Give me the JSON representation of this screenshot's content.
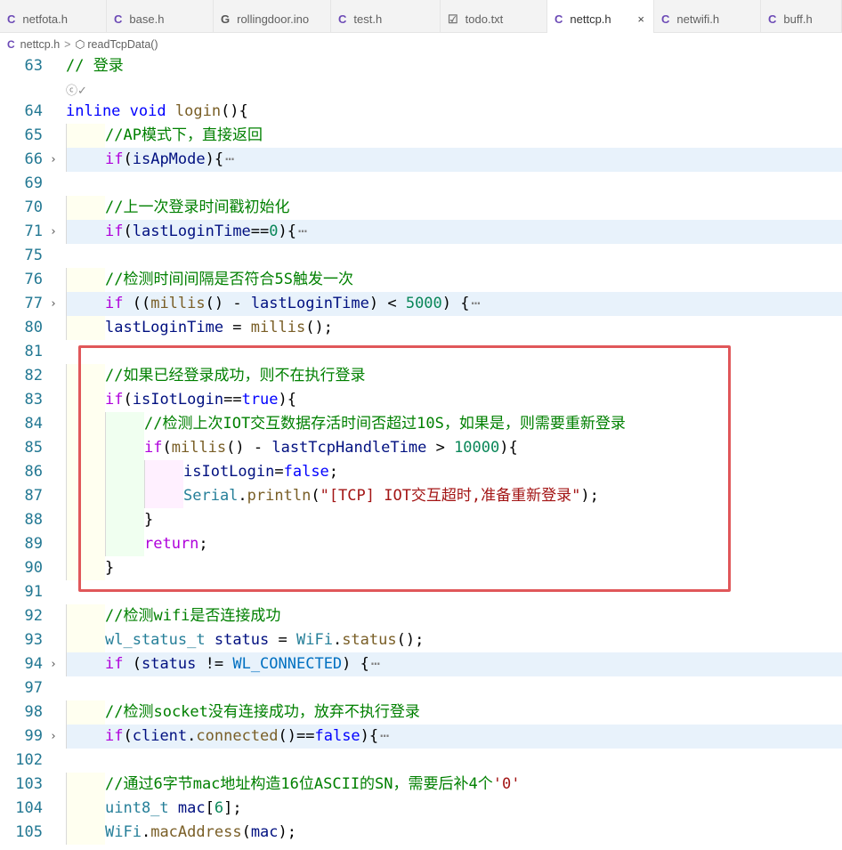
{
  "tabs": [
    {
      "icon": "C",
      "label": "netfota.h",
      "active": false
    },
    {
      "icon": "C",
      "label": "base.h",
      "active": false
    },
    {
      "icon": "G",
      "label": "rollingdoor.ino",
      "active": false
    },
    {
      "icon": "C",
      "label": "test.h",
      "active": false
    },
    {
      "icon": "☑",
      "label": "todo.txt",
      "active": false
    },
    {
      "icon": "C",
      "label": "nettcp.h",
      "active": true,
      "close": "×"
    },
    {
      "icon": "C",
      "label": "netwifi.h",
      "active": false
    },
    {
      "icon": "C",
      "label": "buff.h",
      "active": false
    }
  ],
  "breadcrumb": {
    "file": "nettcp.h",
    "separator": ">",
    "symbol": "readTcpData()"
  },
  "editor": {
    "codelens_hint": "ⓒ✓",
    "lines": [
      {
        "num": "63",
        "indent": 0,
        "tokens": [
          [
            "c",
            "// 登录"
          ]
        ]
      },
      {
        "num": "64",
        "indent": 0,
        "tokens": [
          [
            "k",
            "inline"
          ],
          [
            "p",
            " "
          ],
          [
            "k",
            "void"
          ],
          [
            "p",
            " "
          ],
          [
            "f",
            "login"
          ],
          [
            "p",
            "(){"
          ]
        ]
      },
      {
        "num": "65",
        "indent": 1,
        "tokens": [
          [
            "c",
            "//AP模式下，直接返回"
          ]
        ]
      },
      {
        "num": "66",
        "indent": 1,
        "folded": true,
        "tokens": [
          [
            "kc",
            "if"
          ],
          [
            "p",
            "("
          ],
          [
            "v",
            "isApMode"
          ],
          [
            "p",
            "){"
          ],
          [
            "e",
            "⋯"
          ]
        ]
      },
      {
        "num": "69",
        "indent": 0,
        "tokens": []
      },
      {
        "num": "70",
        "indent": 1,
        "tokens": [
          [
            "c",
            "//上一次登录时间戳初始化"
          ]
        ]
      },
      {
        "num": "71",
        "indent": 1,
        "folded": true,
        "tokens": [
          [
            "kc",
            "if"
          ],
          [
            "p",
            "("
          ],
          [
            "v",
            "lastLoginTime"
          ],
          [
            "p",
            "=="
          ],
          [
            "n",
            "0"
          ],
          [
            "p",
            "){"
          ],
          [
            "e",
            "⋯"
          ]
        ]
      },
      {
        "num": "75",
        "indent": 0,
        "tokens": []
      },
      {
        "num": "76",
        "indent": 1,
        "tokens": [
          [
            "c",
            "//检测时间间隔是否符合5S触发一次"
          ]
        ]
      },
      {
        "num": "77",
        "indent": 1,
        "folded": true,
        "tokens": [
          [
            "kc",
            "if"
          ],
          [
            "p",
            " (("
          ],
          [
            "f",
            "millis"
          ],
          [
            "p",
            "() - "
          ],
          [
            "v",
            "lastLoginTime"
          ],
          [
            "p",
            ") < "
          ],
          [
            "n",
            "5000"
          ],
          [
            "p",
            ") {"
          ],
          [
            "e",
            "⋯"
          ]
        ]
      },
      {
        "num": "80",
        "indent": 1,
        "tokens": [
          [
            "v",
            "lastLoginTime"
          ],
          [
            "p",
            " = "
          ],
          [
            "f",
            "millis"
          ],
          [
            "p",
            "();"
          ]
        ]
      },
      {
        "num": "81",
        "indent": 0,
        "tokens": []
      },
      {
        "num": "82",
        "indent": 1,
        "tokens": [
          [
            "c",
            "//如果已经登录成功，则不在执行登录"
          ]
        ]
      },
      {
        "num": "83",
        "indent": 1,
        "tokens": [
          [
            "kc",
            "if"
          ],
          [
            "p",
            "("
          ],
          [
            "v",
            "isIotLogin"
          ],
          [
            "p",
            "=="
          ],
          [
            "k",
            "true"
          ],
          [
            "p",
            "){"
          ]
        ]
      },
      {
        "num": "84",
        "indent": 2,
        "tokens": [
          [
            "c",
            "//检测上次IOT交互数据存活时间否超过10S，如果是，则需要重新登录"
          ]
        ]
      },
      {
        "num": "85",
        "indent": 2,
        "tokens": [
          [
            "kc",
            "if"
          ],
          [
            "p",
            "("
          ],
          [
            "f",
            "millis"
          ],
          [
            "p",
            "() - "
          ],
          [
            "v",
            "lastTcpHandleTime"
          ],
          [
            "p",
            " > "
          ],
          [
            "n",
            "10000"
          ],
          [
            "p",
            "){"
          ]
        ]
      },
      {
        "num": "86",
        "indent": 3,
        "tokens": [
          [
            "v",
            "isIotLogin"
          ],
          [
            "p",
            "="
          ],
          [
            "k",
            "false"
          ],
          [
            "p",
            ";"
          ]
        ]
      },
      {
        "num": "87",
        "indent": 3,
        "tokens": [
          [
            "t",
            "Serial"
          ],
          [
            "p",
            "."
          ],
          [
            "f",
            "println"
          ],
          [
            "p",
            "("
          ],
          [
            "s",
            "\"[TCP] IOT交互超时,准备重新登录\""
          ],
          [
            "p",
            ");"
          ]
        ]
      },
      {
        "num": "88",
        "indent": 2,
        "tokens": [
          [
            "p",
            "}"
          ]
        ]
      },
      {
        "num": "89",
        "indent": 2,
        "tokens": [
          [
            "kc",
            "return"
          ],
          [
            "p",
            ";"
          ]
        ]
      },
      {
        "num": "90",
        "indent": 1,
        "tokens": [
          [
            "p",
            "}"
          ]
        ]
      },
      {
        "num": "91",
        "indent": 0,
        "tokens": []
      },
      {
        "num": "92",
        "indent": 1,
        "tokens": [
          [
            "c",
            "//检测wifi是否连接成功"
          ]
        ]
      },
      {
        "num": "93",
        "indent": 1,
        "tokens": [
          [
            "t",
            "wl_status_t"
          ],
          [
            "p",
            " "
          ],
          [
            "v",
            "status"
          ],
          [
            "p",
            " = "
          ],
          [
            "t",
            "WiFi"
          ],
          [
            "p",
            "."
          ],
          [
            "f",
            "status"
          ],
          [
            "p",
            "();"
          ]
        ]
      },
      {
        "num": "94",
        "indent": 1,
        "folded": true,
        "tokens": [
          [
            "kc",
            "if"
          ],
          [
            "p",
            " ("
          ],
          [
            "v",
            "status"
          ],
          [
            "p",
            " != "
          ],
          [
            "m",
            "WL_CONNECTED"
          ],
          [
            "p",
            ") {"
          ],
          [
            "e",
            "⋯"
          ]
        ]
      },
      {
        "num": "97",
        "indent": 0,
        "tokens": []
      },
      {
        "num": "98",
        "indent": 1,
        "tokens": [
          [
            "c",
            "//检测socket没有连接成功，放弃不执行登录"
          ]
        ]
      },
      {
        "num": "99",
        "indent": 1,
        "folded": true,
        "tokens": [
          [
            "kc",
            "if"
          ],
          [
            "p",
            "("
          ],
          [
            "v",
            "client"
          ],
          [
            "p",
            "."
          ],
          [
            "f",
            "connected"
          ],
          [
            "p",
            "()=="
          ],
          [
            "k",
            "false"
          ],
          [
            "p",
            "){"
          ],
          [
            "e",
            "⋯"
          ]
        ]
      },
      {
        "num": "102",
        "indent": 0,
        "tokens": []
      },
      {
        "num": "103",
        "indent": 1,
        "tokens": [
          [
            "c",
            "//通过6字节mac地址构造16位ASCII的SN，需要后补4个"
          ],
          [
            "s",
            "'0'"
          ]
        ]
      },
      {
        "num": "104",
        "indent": 1,
        "tokens": [
          [
            "t",
            "uint8_t"
          ],
          [
            "p",
            " "
          ],
          [
            "v",
            "mac"
          ],
          [
            "p",
            "["
          ],
          [
            "n",
            "6"
          ],
          [
            "p",
            "];"
          ]
        ]
      },
      {
        "num": "105",
        "indent": 1,
        "tokens": [
          [
            "t",
            "WiFi"
          ],
          [
            "p",
            "."
          ],
          [
            "f",
            "macAddress"
          ],
          [
            "p",
            "("
          ],
          [
            "v",
            "mac"
          ],
          [
            "p",
            ");"
          ]
        ]
      }
    ]
  },
  "colors": {
    "comment": "#008000",
    "keyword": "#0000ff",
    "control": "#af00db",
    "function": "#795e26",
    "variable": "#001080",
    "type": "#267f99",
    "number": "#098658",
    "string": "#a31515",
    "macro": "#0070c1",
    "ellipsis": "#808080",
    "highlight": "#e8f2fb",
    "selection_box": "#e0575a"
  }
}
